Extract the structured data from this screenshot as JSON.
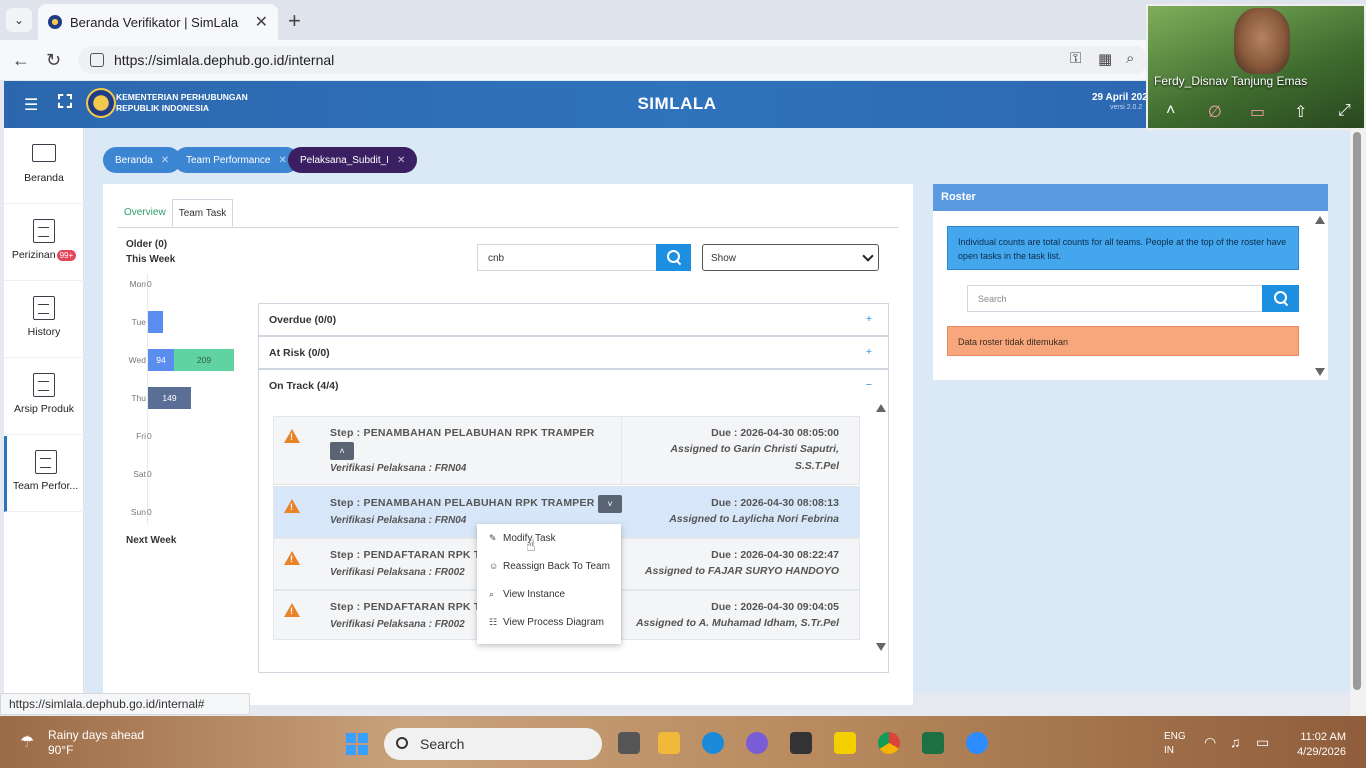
{
  "browser": {
    "tab_title": "Beranda Verifikator | SimLala",
    "url": "https://simlala.dephub.go.id/internal",
    "status_url": "https://simlala.dephub.go.id/internal#"
  },
  "header": {
    "org_line1": "KEMENTERIAN PERHUBUNGAN",
    "org_line2": "REPUBLIK INDONESIA",
    "app_title": "SIMLALA",
    "date": "29 April 2026",
    "version": "versi 2.0.2"
  },
  "sidebar": {
    "items": [
      {
        "label": "Beranda"
      },
      {
        "label": "Perizinan",
        "badge": "99+"
      },
      {
        "label": "History"
      },
      {
        "label": "Arsip Produk"
      },
      {
        "label": "Team Perfor..."
      }
    ]
  },
  "breadcrumbs": [
    {
      "label": "Beranda"
    },
    {
      "label": "Team Performance"
    },
    {
      "label": "Pelaksana_Subdit_I"
    }
  ],
  "tabs": [
    {
      "label": "Overview"
    },
    {
      "label": "Team Task"
    }
  ],
  "chart_data": {
    "type": "bar",
    "orientation": "horizontal",
    "older_label": "Older (0)",
    "this_week_label": "This Week",
    "next_week_label": "Next Week",
    "categories": [
      "Mon",
      "Tue",
      "Wed",
      "Thu",
      "Fri",
      "Sat",
      "Sun"
    ],
    "zero_labels": [
      "0",
      "0",
      "0",
      "0",
      "0",
      "0",
      "0"
    ],
    "series": [
      {
        "values": [
          0,
          0,
          94,
          0,
          0,
          0,
          0
        ],
        "color": "#5b8def"
      },
      {
        "values": [
          0,
          0,
          209,
          0,
          0,
          0,
          0
        ],
        "color": "#5fd3a0"
      },
      {
        "values": [
          0,
          0,
          0,
          149,
          0,
          0,
          0
        ],
        "color": "#5b6e96"
      }
    ],
    "bar_labels": {
      "wed_a": "94",
      "wed_b": "209",
      "thu": "149"
    }
  },
  "filter": {
    "search_value": "cnb",
    "show_label": "Show"
  },
  "accordion": [
    {
      "label": "Overdue (0/0)",
      "sign": "+"
    },
    {
      "label": "At Risk (0/0)",
      "sign": "+"
    },
    {
      "label": "On Track (4/4)",
      "sign": "−"
    }
  ],
  "tasks": [
    {
      "step": "Step : PENAMBAHAN PELABUHAN RPK TRAMPER",
      "verif": "Verifikasi Pelaksana : FRN04",
      "due_label": "Due :",
      "due": "2026-04-30 08:05:00",
      "assign1": "Assigned to Garin Christi Saputri,",
      "assign2": "S.S.T.Pel"
    },
    {
      "step": "Step : PENAMBAHAN PELABUHAN RPK TRAMPER",
      "verif": "Verifikasi Pelaksana : FRN04",
      "due_label": "Due :",
      "due": "2026-04-30 08:08:13",
      "assign1": "Assigned to Laylicha Nori Febrina"
    },
    {
      "step": "Step : PENDAFTARAN RPK T",
      "verif": "Verifikasi Pelaksana : FR002",
      "due_label": "Due :",
      "due": "2026-04-30 08:22:47",
      "assign1": "Assigned to FAJAR SURYO HANDOYO"
    },
    {
      "step": "Step : PENDAFTARAN RPK T",
      "verif": "Verifikasi Pelaksana : FR002",
      "due_label": "Due :",
      "due": "2026-04-30 09:04:05",
      "assign1": "Assigned to A. Muhamad Idham, S.Tr.Pel"
    }
  ],
  "context_menu": [
    {
      "label": "Modify Task",
      "icon": "edit-icon"
    },
    {
      "label": "Reassign Back To Team",
      "icon": "users-icon"
    },
    {
      "label": "View Instance",
      "icon": "search-icon"
    },
    {
      "label": "View Process Diagram",
      "icon": "diagram-icon"
    }
  ],
  "roster": {
    "title": "Roster",
    "info": "Individual counts are total counts for all teams. People at the top of the roster have open tasks in the task list.",
    "search_placeholder": "Search",
    "empty": "Data roster tidak ditemukan"
  },
  "video": {
    "name": "Ferdy_Disnav Tanjung Emas"
  },
  "taskbar": {
    "weather1": "Rainy days ahead",
    "weather2": "90°F",
    "search": "Search",
    "lang1": "ENG",
    "lang2": "IN",
    "time": "11:02 AM",
    "date": "4/29/2026"
  },
  "colors": {
    "header": "#2f73bd",
    "chip_blue": "#3c85d2",
    "chip_dark": "#3b1f63",
    "accent": "#1d8fe1"
  }
}
